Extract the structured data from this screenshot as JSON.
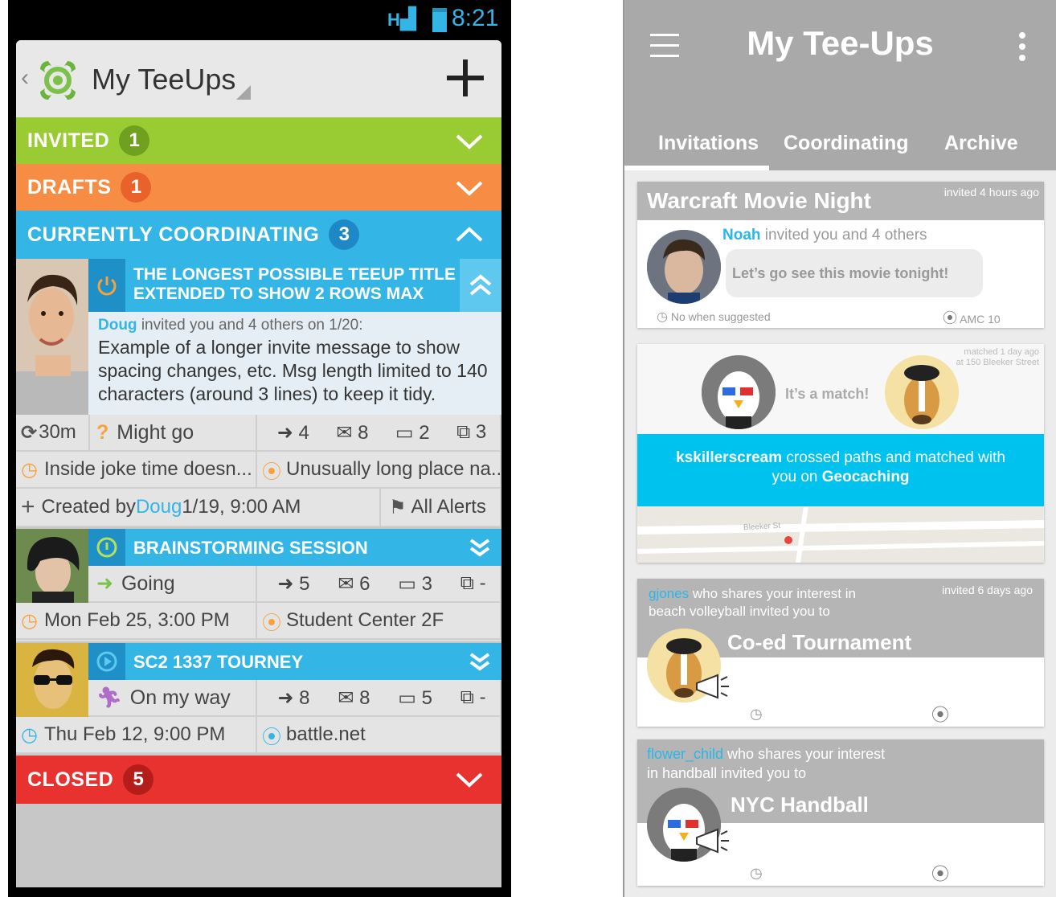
{
  "left": {
    "status": {
      "time": "8:21",
      "network": "H"
    },
    "header": {
      "title": "My TeeUps"
    },
    "sections": {
      "invited": {
        "label": "INVITED",
        "count": "1",
        "color": "#99cc33"
      },
      "drafts": {
        "label": "DRAFTS",
        "count": "1",
        "color": "#f78c45"
      },
      "coordinating": {
        "label": "CURRENTLY COORDINATING",
        "count": "3",
        "color": "#33b5e5"
      },
      "closed": {
        "label": "CLOSED",
        "count": "5",
        "color": "#e8322f"
      }
    },
    "card1": {
      "title_line1": "THE LONGEST POSSIBLE TEEUP TITLE",
      "title_line2": "EXTENDED TO SHOW 2 ROWS MAX",
      "inviter": "Doug",
      "invite_text": " invited you and 4 others on 1/20:",
      "message": "Example of a longer invite message to show spacing changes, etc. Msg length limited to 140 characters (around 3 lines) to keep it tidy.",
      "duration": "30m",
      "status": "Might go",
      "going": "4",
      "mail": "8",
      "comments": "2",
      "games": "3",
      "when": "Inside joke time doesn...",
      "where": "Unusually long place na...",
      "created_prefix": "Created by ",
      "created_by": "Doug",
      "created_date": " 1/19, 9:00 AM",
      "alerts": "All Alerts"
    },
    "card2": {
      "title": "BRAINSTORMING SESSION",
      "status": "Going",
      "going": "5",
      "mail": "6",
      "comments": "3",
      "games": "-",
      "when": "Mon Feb 25, 3:00 PM",
      "where": "Student Center 2F"
    },
    "card3": {
      "title": "SC2 1337 TOURNEY",
      "status": "On my way",
      "going": "8",
      "mail": "8",
      "comments": "5",
      "games": "-",
      "when": "Thu Feb 12, 9:00 PM",
      "where": "battle.net"
    }
  },
  "right": {
    "header": {
      "title": "My Tee-Ups"
    },
    "tabs": [
      "Invitations",
      "Coordinating",
      "Archive"
    ],
    "card1": {
      "title": "Warcraft Movie Night",
      "time_ago": "invited 4 hours ago",
      "inviter": "Noah",
      "invite_text": " invited you and 4 others",
      "message": "Let’s go see this movie tonight!",
      "when": "No when suggested",
      "where": "AMC 10"
    },
    "card2": {
      "time_ago_line1": "matched 1 day ago",
      "time_ago_line2": "at 150 Bleeker Street",
      "match_text": "It’s a match!",
      "user": "kskillerscream",
      "mid_text": " crossed paths and matched with",
      "line2_prefix": "you on ",
      "activity": "Geocaching",
      "map_street": "Bleeker St"
    },
    "card3": {
      "user": "gjones",
      "line1_rest": " who shares your interest in",
      "line2": "beach volleyball invited you to",
      "time_ago": "invited 6 days ago",
      "title": "Co-ed Tournament"
    },
    "card4": {
      "user": "flower_child",
      "line1_rest": " who shares your interest",
      "line2": "in handball invited you to",
      "title": "NYC Handball"
    }
  }
}
